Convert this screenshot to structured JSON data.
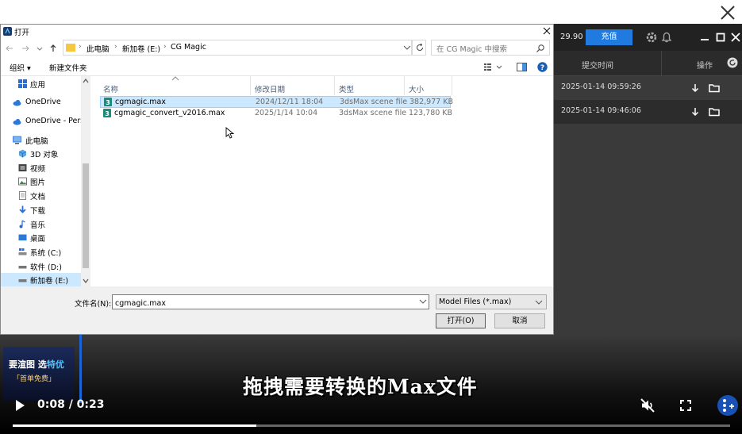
{
  "dialog": {
    "title": "打开",
    "breadcrumb": [
      "此电脑",
      "新加卷 (E:)",
      "CG Magic"
    ],
    "search_placeholder": "在 CG Magic 中搜索",
    "toolbar": {
      "organize": "组织 ▾",
      "new_folder": "新建文件夹"
    },
    "nav_items": [
      {
        "label": "应用",
        "icon": "apps-icon"
      },
      {
        "label": "OneDrive",
        "icon": "cloud-icon"
      },
      {
        "label": "OneDrive - Perso",
        "icon": "cloud-icon"
      },
      {
        "label": "此电脑",
        "icon": "pc-icon"
      },
      {
        "label": "3D 对象",
        "icon": "cube-icon"
      },
      {
        "label": "视频",
        "icon": "video-icon"
      },
      {
        "label": "图片",
        "icon": "picture-icon"
      },
      {
        "label": "文档",
        "icon": "document-icon"
      },
      {
        "label": "下载",
        "icon": "download-icon"
      },
      {
        "label": "音乐",
        "icon": "music-icon"
      },
      {
        "label": "桌面",
        "icon": "desktop-icon"
      },
      {
        "label": "系统 (C:)",
        "icon": "drive-icon"
      },
      {
        "label": "软件 (D:)",
        "icon": "drive-icon"
      },
      {
        "label": "新加卷 (E:)",
        "icon": "drive-icon"
      }
    ],
    "columns": [
      "名称",
      "修改日期",
      "类型",
      "大小"
    ],
    "files": [
      {
        "name": "cgmagic.max",
        "date": "2024/12/11 18:04",
        "type": "3dsMax scene file",
        "size": "382,977 KB"
      },
      {
        "name": "cgmagic_convert_v2016.max",
        "date": "2025/1/14 10:04",
        "type": "3dsMax scene file",
        "size": "123,780 KB"
      }
    ],
    "filename_label": "文件名(N):",
    "filename_value": "cgmagic.max",
    "filetype_value": "Model Files (*.max)",
    "open_button": "打开(O)",
    "cancel_button": "取消"
  },
  "background_app": {
    "balance": "29.90",
    "recharge": "充值",
    "col_submit_time": "提交时间",
    "col_action": "操作",
    "rows": [
      "2025-01-14 09:59:26",
      "2025-01-14 09:46:06"
    ]
  },
  "video": {
    "promo_line1_a": "要渲图 选",
    "promo_line1_b": "特优",
    "promo_line2": "「首单免费」",
    "subtitle": "拖拽需要转换的Max文件",
    "time": "0:08 / 0:23",
    "progress": 0.34
  },
  "colors": {
    "accent": "#1f7be0",
    "selection": "#cce8ff",
    "promo_highlight": "#49c6ff"
  }
}
